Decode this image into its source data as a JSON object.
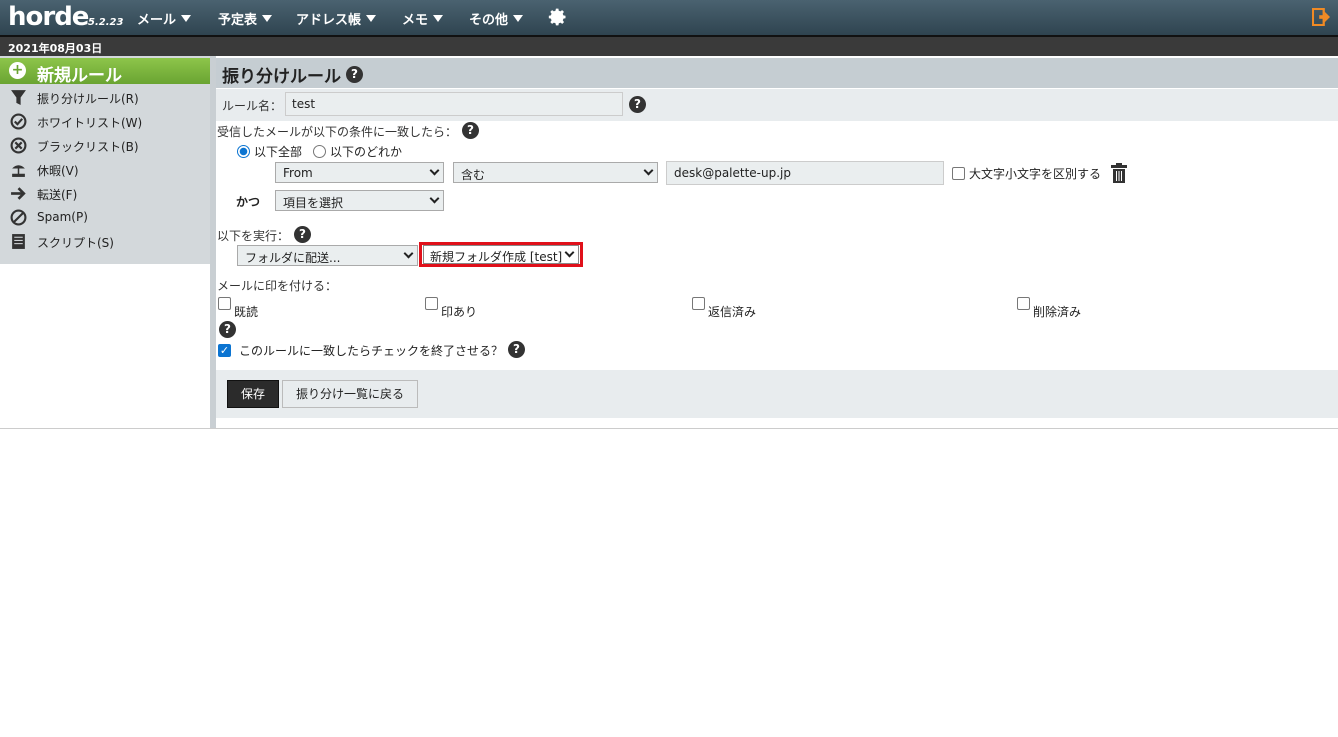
{
  "app": {
    "logo": "horde",
    "version": "5.2.23"
  },
  "topmenu": [
    {
      "label": "メール"
    },
    {
      "label": "予定表"
    },
    {
      "label": "アドレス帳"
    },
    {
      "label": "メモ"
    },
    {
      "label": "その他"
    }
  ],
  "date": "2021年08月03日",
  "sidebar": {
    "new_rule": "新規ルール",
    "items": [
      {
        "label": "振り分けルール(R)",
        "icon": "filter-icon"
      },
      {
        "label": "ホワイトリスト(W)",
        "icon": "check-circle-icon"
      },
      {
        "label": "ブラックリスト(B)",
        "icon": "x-circle-icon"
      },
      {
        "label": "休暇(V)",
        "icon": "vacation-icon"
      },
      {
        "label": "転送(F)",
        "icon": "arrow-right-icon"
      },
      {
        "label": "Spam(P)",
        "icon": "ban-icon"
      },
      {
        "label": "スクリプト(S)",
        "icon": "script-icon"
      }
    ]
  },
  "main": {
    "title": "振り分けルール",
    "rule_name_label": "ルール名：",
    "rule_name_value": "test",
    "condition_label": "受信したメールが以下の条件に一致したら：",
    "match_all_label": "以下全部",
    "match_any_label": "以下のどれか",
    "match_all_selected": true,
    "condition_field": "From",
    "condition_op": "含む",
    "condition_value": "desk@palette-up.jp",
    "case_label": "大文字小文字を区別する",
    "and_label": "かつ",
    "and_field": "項目を選択",
    "action_label": "以下を実行：",
    "action_select": "フォルダに配送...",
    "folder_select": "新規フォルダ作成 [test]",
    "flags_label": "メールに印を付ける：",
    "flags": [
      "既読",
      "印あり",
      "返信済み",
      "削除済み"
    ],
    "stop_label": "このルールに一致したらチェックを終了させる？",
    "stop_checked": true,
    "save_label": "保存",
    "back_label": "振り分け一覧に戻る"
  },
  "colors": {
    "accent_green": "#7ab83f",
    "topbar": "#3b5260",
    "highlight_red": "#e0101a"
  }
}
